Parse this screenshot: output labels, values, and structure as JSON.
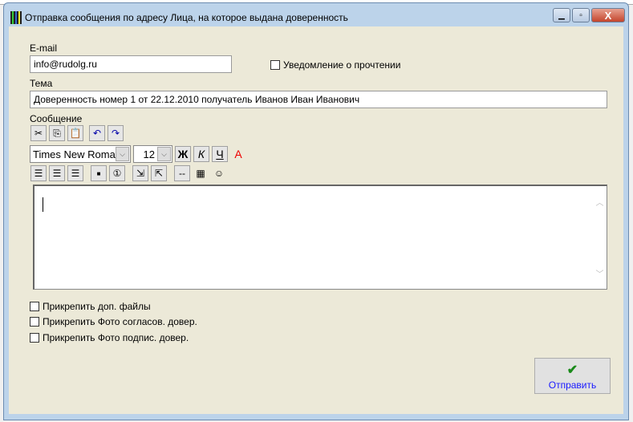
{
  "window": {
    "title": "Отправка сообщения по адресу Лица, на которое выдана доверенность",
    "close": "X"
  },
  "email": {
    "label": "E-mail",
    "value": "info@rudolg.ru"
  },
  "read_receipt": {
    "label": "Уведомление о прочтении",
    "checked": false
  },
  "subject": {
    "label": "Тема",
    "value": "Доверенность номер 1 от 22.12.2010 получатель Иванов Иван Иванович"
  },
  "message": {
    "label": "Сообщение",
    "value": ""
  },
  "toolbar": {
    "font": "Times New Roman",
    "size": "12",
    "bold": "Ж",
    "italic": "К",
    "underline": "Ч",
    "color": "A",
    "hr": "--",
    "smile": "☺",
    "numbered": "①"
  },
  "attachments": [
    {
      "label": "Прикрепить доп. файлы",
      "checked": false
    },
    {
      "label": "Прикрепить Фото согласов. довер.",
      "checked": false
    },
    {
      "label": "Прикрепить Фото подпис. довер.",
      "checked": false
    }
  ],
  "send_button": {
    "label": "Отправить",
    "icon": "✔"
  }
}
